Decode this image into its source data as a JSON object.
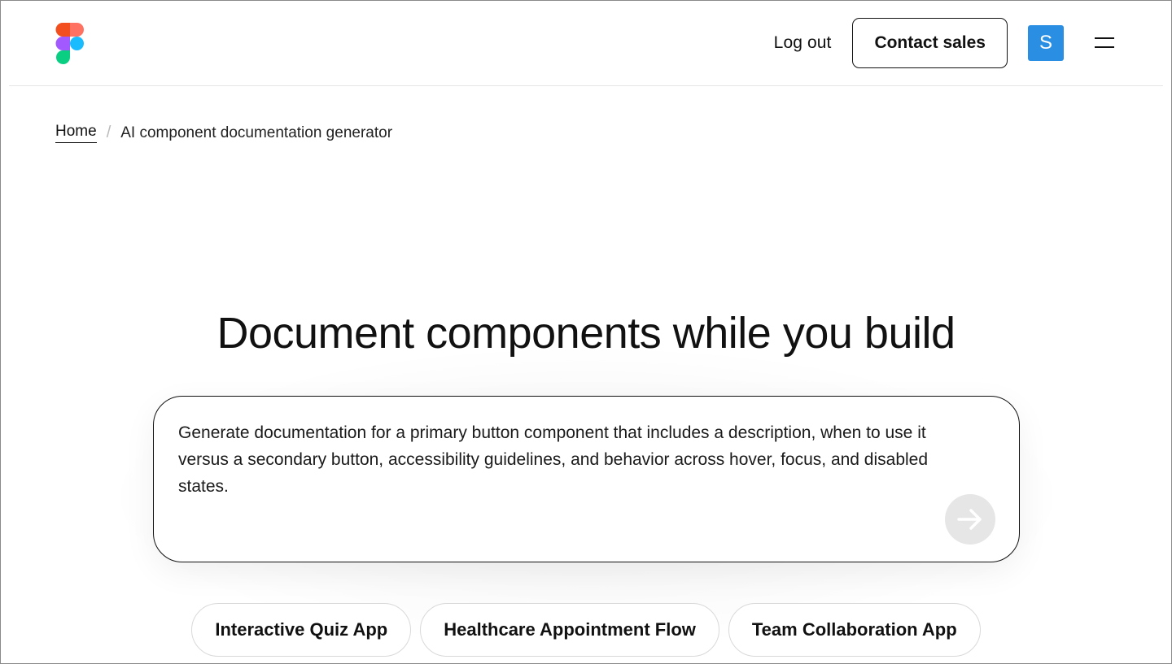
{
  "header": {
    "logout_label": "Log out",
    "contact_label": "Contact sales",
    "avatar_letter": "S",
    "avatar_color": "#2a8ee3"
  },
  "breadcrumb": {
    "home": "Home",
    "separator": "/",
    "current": "AI component documentation generator"
  },
  "hero": {
    "title": "Document components while you build",
    "prompt_value": "Generate documentation for a primary button component that includes a description, when to use it versus a secondary button, accessibility guidelines, and behavior across hover, focus, and disabled states."
  },
  "suggestions": [
    "Interactive Quiz App",
    "Healthcare Appointment Flow",
    "Team Collaboration App"
  ],
  "colors": {
    "logo": [
      "#f24e1e",
      "#ff7262",
      "#a259ff",
      "#1abcfe",
      "#0acf83"
    ],
    "send_button_bg": "#e6e6e6"
  },
  "icons": [
    "figma-logo-icon",
    "hamburger-menu-icon",
    "arrow-right-icon"
  ]
}
